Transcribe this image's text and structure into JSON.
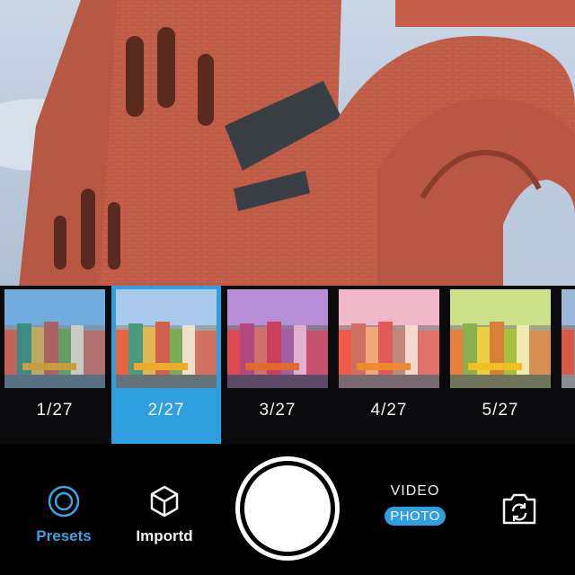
{
  "presets": [
    {
      "label": "1/27",
      "selected": false,
      "tint": "#3a8fd9"
    },
    {
      "label": "2/27",
      "selected": true,
      "tint": "#ffffff"
    },
    {
      "label": "3/27",
      "selected": false,
      "tint": "#b34fd1"
    },
    {
      "label": "4/27",
      "selected": false,
      "tint": "#f06090"
    },
    {
      "label": "5/27",
      "selected": false,
      "tint": "#e6d020"
    }
  ],
  "controls": {
    "presets_label": "Presets",
    "import_label": "Importd",
    "video_label": "VIDEO",
    "photo_label": "PHOTO"
  },
  "colors": {
    "accent": "#2f9fe0",
    "brick": "#c8644a"
  }
}
